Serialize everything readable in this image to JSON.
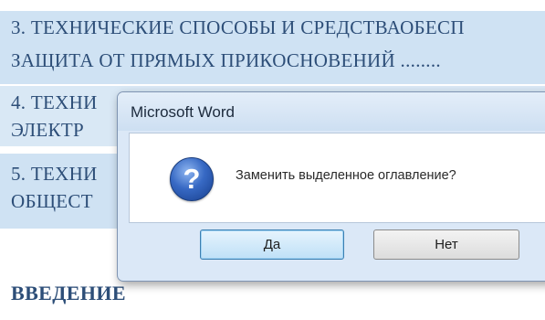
{
  "document": {
    "toc": [
      {
        "line1": "3. ТЕХНИЧЕСКИЕ СПОСОБЫ И СРЕДСТВАОБЕСП",
        "line2": "ЗАЩИТА ОТ ПРЯМЫХ ПРИКОСНОВЕНИЙ ........"
      },
      {
        "line1": "4. ТЕХНИ",
        "line2": "ЭЛЕКТР"
      },
      {
        "line1": "5. ТЕХНИ",
        "line2": "ОБЩЕСТ"
      }
    ],
    "intro_heading": "ВВЕДЕНИЕ"
  },
  "dialog": {
    "title": "Microsoft Word",
    "icon": "question-icon",
    "icon_glyph": "?",
    "message": "Заменить выделенное оглавление?",
    "buttons": {
      "yes": "Да",
      "no": "Нет"
    }
  },
  "colors": {
    "selection_highlight": "#cfe2f3",
    "document_text": "#2d4e78",
    "dialog_frame": "#dbe8f7",
    "default_button": "#bfe0f7"
  }
}
